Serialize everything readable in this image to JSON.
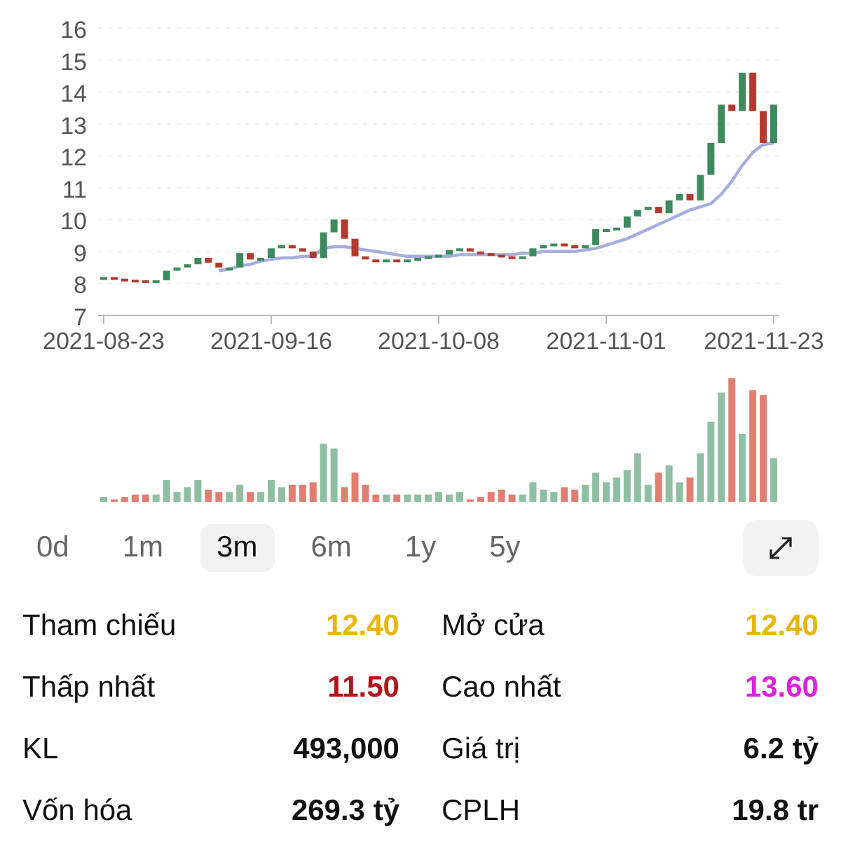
{
  "price_chart": {
    "chart_data": {
      "type": "line",
      "grid": true,
      "categories": [
        "2021-08-23",
        null,
        null,
        null,
        null,
        null,
        null,
        null,
        null,
        null,
        null,
        null,
        null,
        null,
        null,
        null,
        "2021-09-16",
        null,
        null,
        null,
        null,
        null,
        null,
        null,
        null,
        null,
        null,
        null,
        null,
        null,
        null,
        null,
        "2021-10-08",
        null,
        null,
        null,
        null,
        null,
        null,
        null,
        null,
        null,
        null,
        null,
        null,
        null,
        null,
        null,
        "2021-11-01",
        null,
        null,
        null,
        null,
        null,
        null,
        null,
        null,
        null,
        null,
        null,
        null,
        null,
        null,
        null,
        "2021-11-23"
      ],
      "series": [
        {
          "color": "#a3aede",
          "values": [
            null,
            null,
            null,
            null,
            null,
            null,
            null,
            null,
            null,
            null,
            null,
            8.4,
            8.45,
            8.55,
            8.6,
            8.7,
            8.75,
            8.8,
            8.8,
            8.85,
            8.85,
            9.1,
            9.15,
            9.15,
            9.1,
            9.05,
            9.0,
            8.95,
            8.9,
            8.85,
            8.85,
            8.85,
            8.85,
            8.85,
            8.9,
            8.9,
            8.9,
            8.9,
            8.9,
            8.9,
            8.95,
            8.95,
            9.0,
            9.0,
            9.0,
            9.0,
            9.05,
            9.1,
            9.2,
            9.3,
            9.4,
            9.55,
            9.7,
            9.85,
            10.0,
            10.15,
            10.3,
            10.4,
            10.5,
            10.8,
            11.2,
            11.7,
            12.1,
            12.35,
            12.4
          ]
        }
      ],
      "ylim": [
        7,
        16
      ],
      "yticks": [
        7,
        8,
        9,
        10,
        11,
        12,
        13,
        14,
        15,
        16
      ]
    }
  },
  "periods": [
    {
      "label": "0d",
      "selected": false
    },
    {
      "label": "1m",
      "selected": false
    },
    {
      "label": "3m",
      "selected": true
    },
    {
      "label": "6m",
      "selected": false
    },
    {
      "label": "1y",
      "selected": false
    },
    {
      "label": "5y",
      "selected": false
    }
  ],
  "stats": [
    [
      {
        "label": "Tham chiếu",
        "value": "12.40",
        "color": "#e9b600"
      },
      {
        "label": "Mở cửa",
        "value": "12.40",
        "color": "#e9b600"
      }
    ],
    [
      {
        "label": "Thấp nhất",
        "value": "11.50",
        "color": "#b3141a"
      },
      {
        "label": "Cao nhất",
        "value": "13.60",
        "color": "#e01fe0"
      }
    ],
    [
      {
        "label": "KL",
        "value": "493,000",
        "color": "#111111"
      },
      {
        "label": "Giá trị",
        "value": "6.2 tỷ",
        "color": "#111111"
      }
    ],
    [
      {
        "label": "Vốn hóa",
        "value": "269.3 tỷ",
        "color": "#111111"
      },
      {
        "label": "CPLH",
        "value": "19.8 tr",
        "color": "#111111"
      }
    ]
  ]
}
